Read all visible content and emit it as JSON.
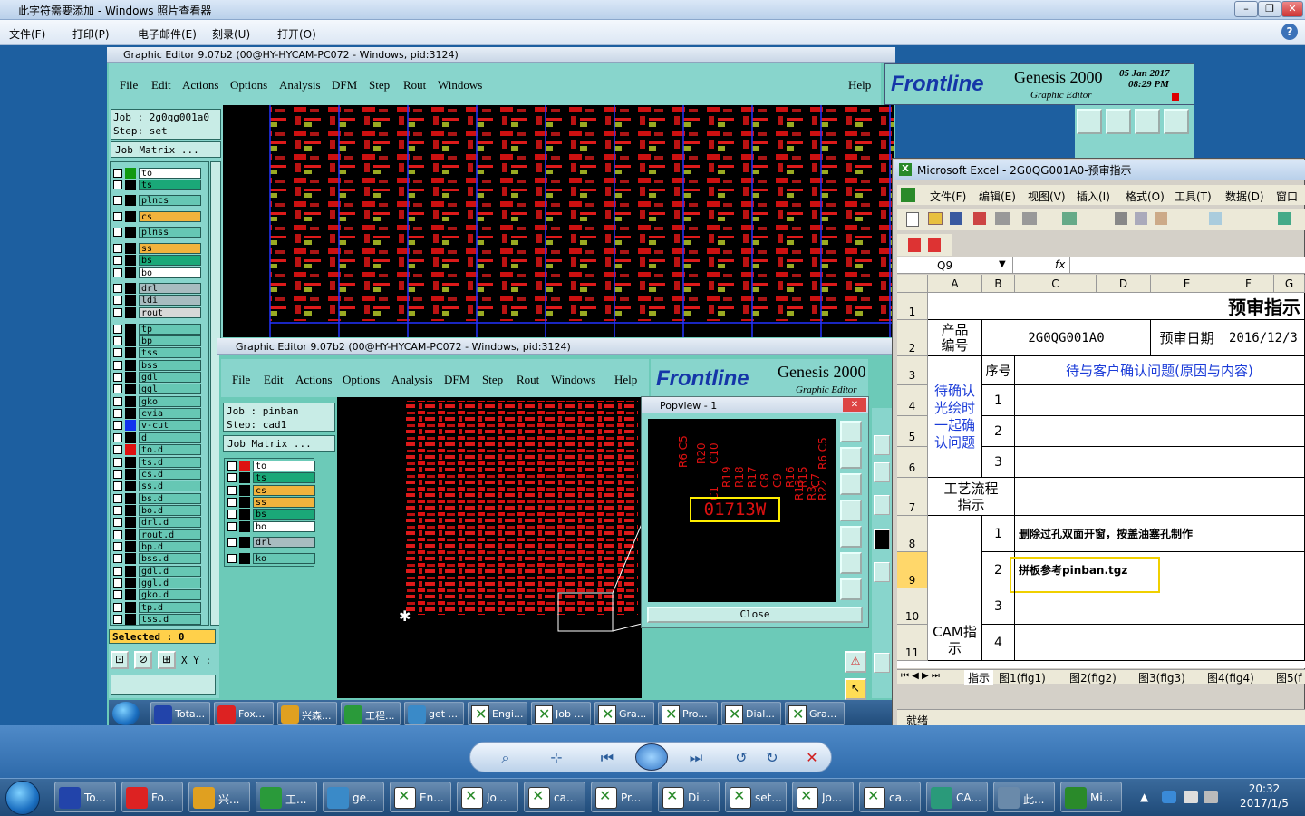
{
  "photo_viewer": {
    "title": "此字符需要添加 - Windows 照片查看器",
    "menu": [
      "文件(F)",
      "打印(P)",
      "电子邮件(E)",
      "刻录(U)",
      "打开(O)"
    ]
  },
  "genesis_main": {
    "title": "Graphic Editor 9.07b2 (00@HY-HYCAM-PC072 - Windows, pid:3124)",
    "menu": [
      "File",
      "Edit",
      "Actions",
      "Options",
      "Analysis",
      "DFM",
      "Step",
      "Rout",
      "Windows",
      "Help"
    ],
    "logo": "Frontline",
    "product": "Genesis 2000",
    "subtitle": "Graphic Editor",
    "date": "05 Jan 2017",
    "time": "08:29 PM",
    "job": "Job : 2g0qg001a0",
    "step": "Step: set",
    "job_matrix": "Job Matrix ...",
    "selected": "Selected : 0",
    "xy": "X Y :",
    "layers": [
      {
        "name": "to",
        "sw": "#119911",
        "bg": "#ffffff"
      },
      {
        "name": "ts",
        "sw": "#000000",
        "bg": "#1aa878"
      },
      {
        "name": "plncs",
        "sw": "#000000",
        "bg": "#66c7b4"
      },
      {
        "name": "cs",
        "sw": "#000000",
        "bg": "#f2b33d"
      },
      {
        "name": "plnss",
        "sw": "#000000",
        "bg": "#66c7b4"
      },
      {
        "name": "ss",
        "sw": "#000000",
        "bg": "#f2b33d"
      },
      {
        "name": "bs",
        "sw": "#000000",
        "bg": "#1aa878"
      },
      {
        "name": "bo",
        "sw": "#000000",
        "bg": "#ffffff"
      },
      {
        "name": "drl",
        "sw": "#000000",
        "bg": "#a8bcc0"
      },
      {
        "name": "ldi",
        "sw": "#000000",
        "bg": "#a8bcc0"
      },
      {
        "name": "rout",
        "sw": "#000000",
        "bg": "#d8d8d8"
      },
      {
        "name": "tp",
        "sw": "#000000",
        "bg": "#66c7b4"
      },
      {
        "name": "bp",
        "sw": "#000000",
        "bg": "#66c7b4"
      },
      {
        "name": "tss",
        "sw": "#000000",
        "bg": "#66c7b4"
      },
      {
        "name": "bss",
        "sw": "#000000",
        "bg": "#66c7b4"
      },
      {
        "name": "gdl",
        "sw": "#000000",
        "bg": "#66c7b4"
      },
      {
        "name": "ggl",
        "sw": "#000000",
        "bg": "#66c7b4"
      },
      {
        "name": "gko",
        "sw": "#000000",
        "bg": "#66c7b4"
      },
      {
        "name": "cvia",
        "sw": "#000000",
        "bg": "#66c7b4"
      },
      {
        "name": "v-cut",
        "sw": "#1133ee",
        "bg": "#66c7b4"
      },
      {
        "name": "d",
        "sw": "#000000",
        "bg": "#66c7b4"
      },
      {
        "name": "to.d",
        "sw": "#dd1111",
        "bg": "#66c7b4"
      },
      {
        "name": "ts.d",
        "sw": "#000000",
        "bg": "#66c7b4"
      },
      {
        "name": "cs.d",
        "sw": "#000000",
        "bg": "#66c7b4"
      },
      {
        "name": "ss.d",
        "sw": "#000000",
        "bg": "#66c7b4"
      },
      {
        "name": "bs.d",
        "sw": "#000000",
        "bg": "#66c7b4"
      },
      {
        "name": "bo.d",
        "sw": "#000000",
        "bg": "#66c7b4"
      },
      {
        "name": "drl.d",
        "sw": "#000000",
        "bg": "#66c7b4"
      },
      {
        "name": "rout.d",
        "sw": "#000000",
        "bg": "#66c7b4"
      },
      {
        "name": "bp.d",
        "sw": "#000000",
        "bg": "#66c7b4"
      },
      {
        "name": "bss.d",
        "sw": "#000000",
        "bg": "#66c7b4"
      },
      {
        "name": "gdl.d",
        "sw": "#000000",
        "bg": "#66c7b4"
      },
      {
        "name": "ggl.d",
        "sw": "#000000",
        "bg": "#66c7b4"
      },
      {
        "name": "gko.d",
        "sw": "#000000",
        "bg": "#66c7b4"
      },
      {
        "name": "tp.d",
        "sw": "#000000",
        "bg": "#66c7b4"
      },
      {
        "name": "tss.d",
        "sw": "#000000",
        "bg": "#66c7b4"
      }
    ]
  },
  "genesis_second": {
    "title": "Graphic Editor 9.07b2 (00@HY-HYCAM-PC072 - Windows, pid:3124)",
    "menu": [
      "File",
      "Edit",
      "Actions",
      "Options",
      "Analysis",
      "DFM",
      "Step",
      "Rout",
      "Windows",
      "Help"
    ],
    "logo": "Frontline",
    "product": "Genesis 2000",
    "subtitle": "Graphic Editor",
    "job": "Job : pinban",
    "step": "Step: cad1",
    "job_matrix": "Job Matrix ...",
    "layers": [
      {
        "name": "to",
        "sw": "#dd1111",
        "bg": "#ffffff"
      },
      {
        "name": "ts",
        "sw": "#000000",
        "bg": "#1aa878"
      },
      {
        "name": "cs",
        "sw": "#000000",
        "bg": "#f2b33d"
      },
      {
        "name": "ss",
        "sw": "#000000",
        "bg": "#f2b33d"
      },
      {
        "name": "bs",
        "sw": "#000000",
        "bg": "#1aa878"
      },
      {
        "name": "bo",
        "sw": "#000000",
        "bg": "#ffffff"
      },
      {
        "name": "drl",
        "sw": "#000000",
        "bg": "#a8bcc0"
      },
      {
        "name": "ko",
        "sw": "#000000",
        "bg": "#66c7b4"
      }
    ]
  },
  "popview": {
    "title": "Popview - 1",
    "highlight": "01713W",
    "labels": [
      "R6 C5",
      "R20",
      "C10",
      "R19",
      "R18",
      "R17",
      "C8",
      "C9",
      "R16",
      "R15",
      "C7",
      "C1",
      "R22",
      "R13",
      "R3",
      "R6 C5"
    ],
    "close": "Close"
  },
  "excel": {
    "title": "Microsoft Excel - 2G0QG001A0-预审指示",
    "menu": [
      "文件(F)",
      "编辑(E)",
      "视图(V)",
      "插入(I)",
      "格式(O)",
      "工具(T)",
      "数据(D)",
      "窗口"
    ],
    "name_box": "Q9",
    "fx": "fx",
    "columns": [
      "A",
      "B",
      "C",
      "D",
      "E",
      "F",
      "G"
    ],
    "rows": [
      "1",
      "2",
      "3",
      "4",
      "5",
      "6",
      "7",
      "8",
      "9",
      "10",
      "11"
    ],
    "sheet_title": "预审指示",
    "product_label": "产品编号",
    "product_no": "2G0QG001A0",
    "date_label": "预审日期",
    "date_value": "2016/12/3",
    "seq_label": "序号",
    "pending_header": "待与客户确认问题(原因与内容)",
    "confirm_label": "待确认光绘时一起确认问题",
    "process_label": "工艺流程指示",
    "cam_label": "CAM指示",
    "n1": "1",
    "n2": "2",
    "n3": "3",
    "n4": "4",
    "instr1": "删除过孔双面开窗，按盖油塞孔制作",
    "instr2": "拼板参考pinban.tgz",
    "sheets": [
      "指示",
      "图1(fig1)",
      "图2(fig2)",
      "图3(fig3)",
      "图4(fig4)",
      "图5(f"
    ],
    "status": "就绪"
  },
  "genesis_taskbar": [
    "Tota...",
    "Fox...",
    "兴森...",
    "工程...",
    "get ...",
    "Engi...",
    "Job ...",
    "Gra...",
    "Pro...",
    "Dial...",
    "Gra..."
  ],
  "taskbar": {
    "items": [
      "To...",
      "Fo...",
      "兴...",
      "工...",
      "ge...",
      "En...",
      "Jo...",
      "ca...",
      "Pr...",
      "Di...",
      "set...",
      "Jo...",
      "ca...",
      "CA...",
      "此...",
      "Mi..."
    ],
    "time": "20:32",
    "date": "2017/1/5"
  },
  "colors": {
    "accent_teal": "#88d5cc",
    "board_red": "#dd1111",
    "highlight": "#ffee00"
  }
}
